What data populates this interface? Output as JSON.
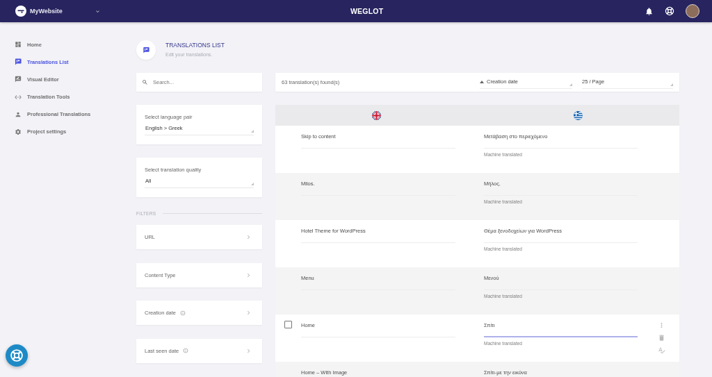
{
  "header": {
    "site_name": "MyWebsite",
    "brand": "WEGLOT"
  },
  "sidebar": {
    "items": [
      {
        "label": "Home",
        "selected": false
      },
      {
        "label": "Translations List",
        "selected": true
      },
      {
        "label": "Visual Editor",
        "selected": false
      },
      {
        "label": "Translation Tools",
        "selected": false
      },
      {
        "label": "Professional Translations",
        "selected": false
      },
      {
        "label": "Project settings",
        "selected": false
      }
    ]
  },
  "page": {
    "title": "TRANSLATIONS LIST",
    "subtitle": "Edit your translations."
  },
  "search": {
    "placeholder": "Search..."
  },
  "selects": [
    {
      "label": "Select language pair",
      "value": "English > Greek"
    },
    {
      "label": "Select translation quality",
      "value": "All"
    }
  ],
  "filters": {
    "heading": "FILTERS",
    "items": [
      {
        "label": "URL",
        "info": false
      },
      {
        "label": "Content Type",
        "info": false
      },
      {
        "label": "Creation date",
        "info": true
      },
      {
        "label": "Last seen date",
        "info": true
      }
    ]
  },
  "toolbar": {
    "count": "63 translation(s) found(s)",
    "sort": "Creation date",
    "per_page": "25 / Page"
  },
  "table": {
    "rows": [
      {
        "source": "Skip to content",
        "target": "Μετάβαση στο περιεχόμενο",
        "status": "Machine translated",
        "hovered": false,
        "checked": false,
        "focused": false
      },
      {
        "source": "Milos.",
        "target": "Μήλος.",
        "status": "Machine translated",
        "hovered": false,
        "checked": false,
        "focused": false
      },
      {
        "source": "Hotel Theme for WordPress",
        "target": "Θέμα ξενοδοχείων για WordPress",
        "status": "Machine translated",
        "hovered": false,
        "checked": false,
        "focused": false
      },
      {
        "source": "Menu",
        "target": "Μενού",
        "status": "Machine translated",
        "hovered": false,
        "checked": false,
        "focused": false
      },
      {
        "source": "Home",
        "target": "Σπίτι",
        "status": "Machine translated",
        "hovered": true,
        "checked": false,
        "focused": true
      },
      {
        "source": "Home – With Image",
        "target": "Σπίτι-με την εικόνα",
        "hovered": false,
        "checked": false
      }
    ]
  }
}
